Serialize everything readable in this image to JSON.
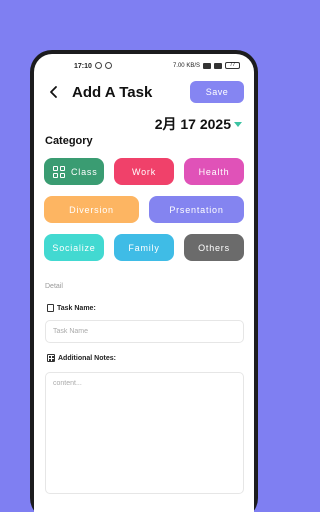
{
  "status_bar": {
    "time": "17:10",
    "speed": "7.00 KB/S",
    "battery": "77"
  },
  "header": {
    "title": "Add A Task",
    "save_label": "Save"
  },
  "date": {
    "text": "2月 17 2025"
  },
  "category": {
    "title": "Category",
    "items": [
      {
        "label": "Class",
        "color": "#3a9c72"
      },
      {
        "label": "Work",
        "color": "#f0416a"
      },
      {
        "label": "Health",
        "color": "#e052b8"
      },
      {
        "label": "Diversion",
        "color": "#fdb562"
      },
      {
        "label": "Prsentation",
        "color": "#8484f0"
      },
      {
        "label": "Socialize",
        "color": "#42d9d1"
      },
      {
        "label": "Family",
        "color": "#3fbce6"
      },
      {
        "label": "Others",
        "color": "#6b6b6b"
      }
    ]
  },
  "detail": {
    "section_label": "Detail",
    "task_name_label": "Task Name:",
    "task_name_placeholder": "Task Name",
    "task_name_value": "",
    "notes_label": "Additional Notes:",
    "notes_placeholder": "content...",
    "notes_value": ""
  },
  "colors": {
    "background": "#7f7ff2",
    "accent": "#8585f2",
    "date_caret": "#3cc3a2"
  },
  "icons": {
    "back": "arrow-left-icon",
    "category_class": "grid-icon",
    "task_name": "document-icon",
    "notes": "notes-icon"
  }
}
